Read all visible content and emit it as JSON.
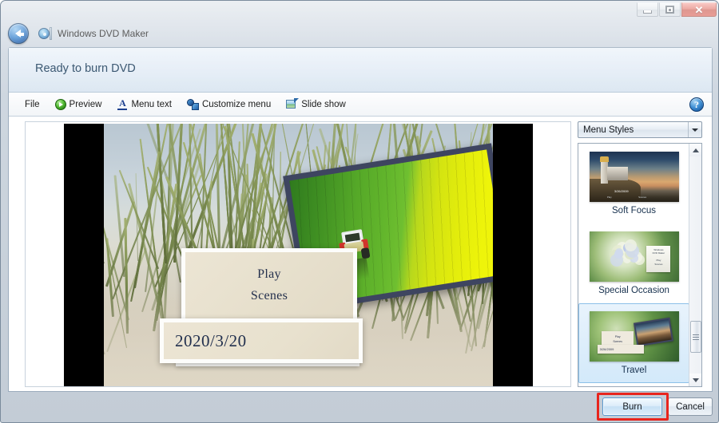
{
  "window": {
    "app_title": "Windows DVD Maker",
    "back_icon": "back-arrow-icon",
    "app_icon": "dvd-maker-icon",
    "controls": {
      "minimize": "minimize-icon",
      "restore": "restore-icon",
      "close": "✕"
    }
  },
  "header": {
    "title": "Ready to burn DVD"
  },
  "toolbar": {
    "items": [
      {
        "label": "File",
        "icon": ""
      },
      {
        "label": "Preview",
        "icon": "play-icon"
      },
      {
        "label": "Menu text",
        "icon": "text-underline-icon"
      },
      {
        "label": "Customize menu",
        "icon": "shapes-icon"
      },
      {
        "label": "Slide show",
        "icon": "slideshow-icon"
      }
    ],
    "help_label": "?",
    "help_icon": "help-icon"
  },
  "preview": {
    "menu_items": [
      "Play",
      "Scenes"
    ],
    "date_text": "2020/3/20",
    "background_description": "beach dune grass",
    "photo_description": "tractor in green and yellow rapeseed field"
  },
  "sidebar": {
    "combo": {
      "label": "Menu Styles",
      "arrow_icon": "chevron-down-icon"
    },
    "styles": [
      {
        "name": "Soft Focus",
        "selected": false
      },
      {
        "name": "Special Occasion",
        "selected": false
      },
      {
        "name": "Travel",
        "selected": true
      }
    ],
    "style_card_text": {
      "soft_focus_date": "3/26/2009",
      "soft_focus_nav1": "Play",
      "soft_focus_nav2": "Scenes",
      "special_card_line1": "Windows",
      "special_card_line2": "DVD Maker",
      "special_card_line3": "Play",
      "special_card_line4": "Scenes",
      "travel_card_line1": "Play",
      "travel_card_line2": "Scenes",
      "travel_date": "3/26/2009"
    },
    "scrollbar": {
      "up_icon": "scroll-up-icon",
      "down_icon": "scroll-down-icon"
    }
  },
  "footer": {
    "burn_label": "Burn",
    "cancel_label": "Cancel"
  },
  "annotation": {
    "highlight_color": "#e8251d",
    "target": "Burn"
  }
}
